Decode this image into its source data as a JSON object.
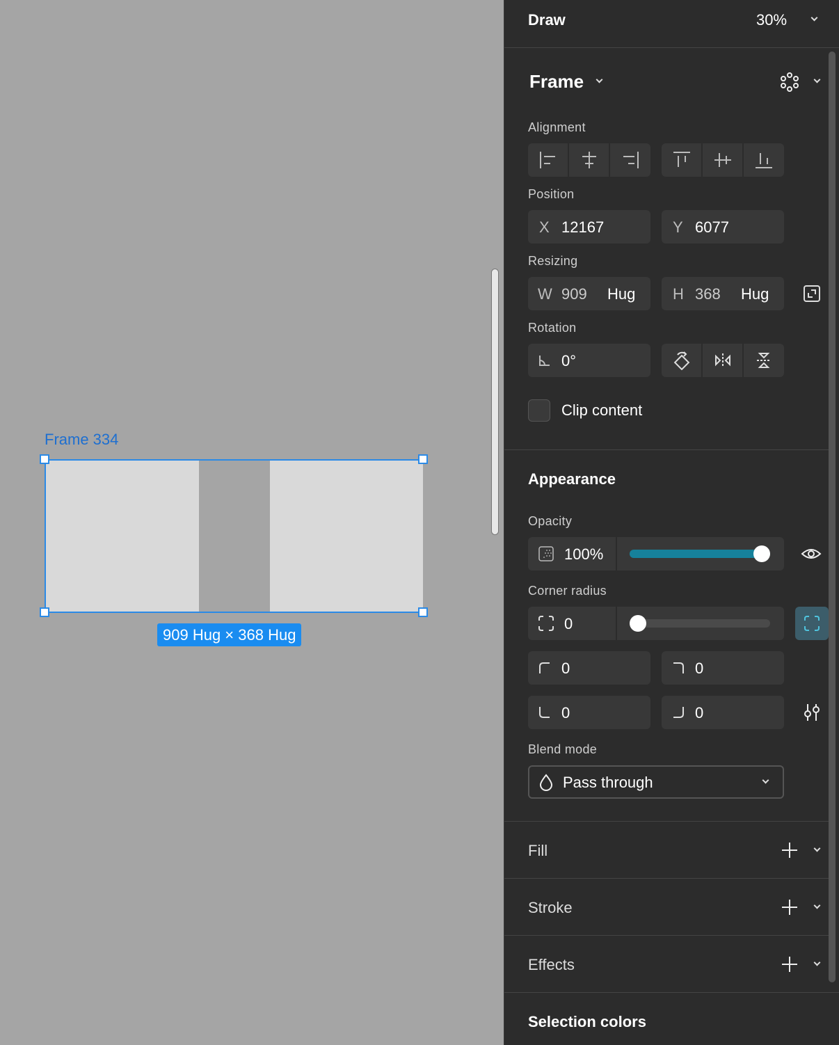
{
  "canvas": {
    "frame_name": "Frame 334",
    "size_badge": "909 Hug × 368 Hug"
  },
  "toolbar": {
    "mode": "Draw",
    "zoom": "30%"
  },
  "frame_section": {
    "title": "Frame",
    "alignment_label": "Alignment",
    "position_label": "Position",
    "x_prefix": "X",
    "x_value": "12167",
    "y_prefix": "Y",
    "y_value": "6077",
    "resizing_label": "Resizing",
    "w_prefix": "W",
    "w_value": "909",
    "w_mode": "Hug",
    "h_prefix": "H",
    "h_value": "368",
    "h_mode": "Hug",
    "rotation_label": "Rotation",
    "rotation_value": "0°",
    "clip_label": "Clip content",
    "clip_checked": false
  },
  "appearance": {
    "title": "Appearance",
    "opacity_label": "Opacity",
    "opacity_value": "100%",
    "opacity_level": 1.0,
    "corner_label": "Corner radius",
    "corner_value": "0",
    "corner_level": 0,
    "corner_tl": "0",
    "corner_tr": "0",
    "corner_bl": "0",
    "corner_br": "0",
    "blend_label": "Blend mode",
    "blend_value": "Pass through"
  },
  "sections": {
    "fill": "Fill",
    "stroke": "Stroke",
    "effects": "Effects",
    "selection_colors": "Selection colors"
  },
  "colors": {
    "accent": "#1a8cf0",
    "slider_fill": "#16819b",
    "panel_bg": "#2c2c2c",
    "canvas_bg": "#a5a5a5"
  }
}
